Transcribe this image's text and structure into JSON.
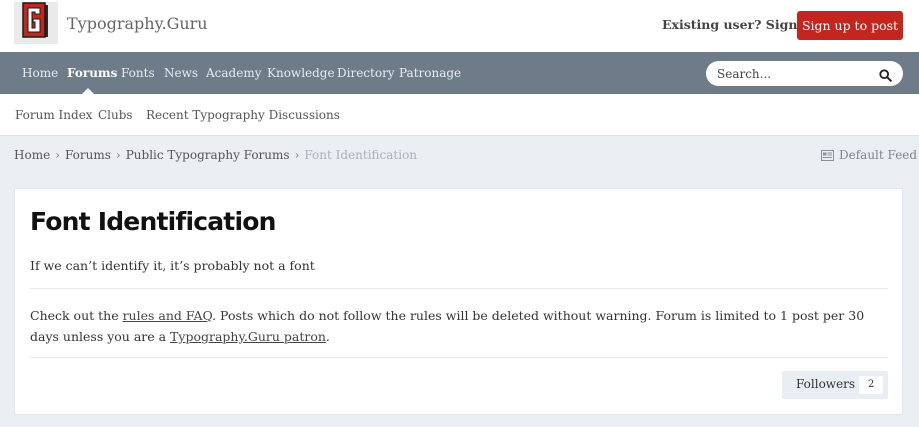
{
  "header": {
    "site_title": "Typography.Guru",
    "logo_icon": "typography-guru-logo",
    "signin_label": "Existing user? Sign In",
    "signup_label": "Sign up to post",
    "brand_color": "#c4261d"
  },
  "nav": {
    "items": [
      {
        "label": "Home"
      },
      {
        "label": "Forums",
        "active": true
      },
      {
        "label": "Fonts"
      },
      {
        "label": "News"
      },
      {
        "label": "Academy"
      },
      {
        "label": "Knowledge"
      },
      {
        "label": "Directory"
      },
      {
        "label": "Patronage"
      }
    ],
    "background": "#6e7c89"
  },
  "search": {
    "placeholder": "Search...",
    "icon": "search-icon"
  },
  "subnav": {
    "items": [
      {
        "label": "Forum Index"
      },
      {
        "label": "Clubs"
      },
      {
        "label": "Recent Typography Discussions"
      }
    ]
  },
  "breadcrumb": {
    "items": [
      "Home",
      "Forums",
      "Public Typography Forums"
    ],
    "current": "Font Identification",
    "feed_label": "Default Feed",
    "feed_icon": "feed-icon"
  },
  "forum": {
    "title": "Font Identification",
    "tagline": "If we can’t identify it, it’s probably not a font",
    "desc_prefix": "Check out the ",
    "rules_link": "rules and FAQ",
    "desc_middle": ". Posts which do not follow the rules will be deleted without warning. Forum is limited to 1 post per 30 days unless you are a ",
    "patron_link": "Typography.Guru patron",
    "desc_suffix": ".",
    "followers_label": "Followers",
    "followers_count": "2"
  }
}
